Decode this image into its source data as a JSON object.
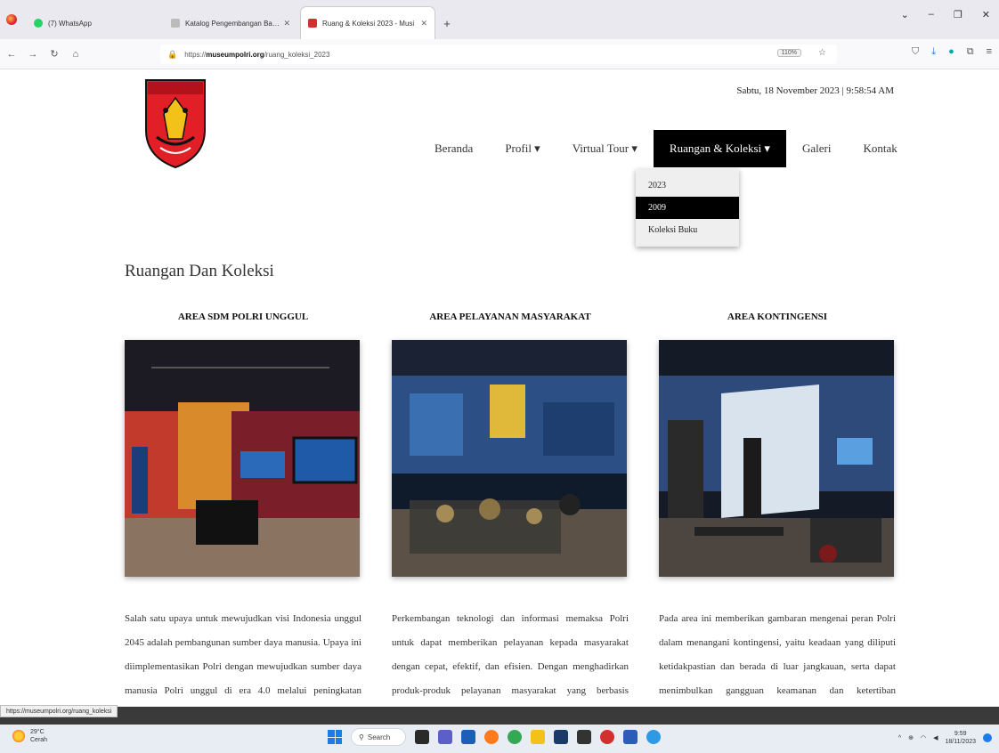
{
  "browser": {
    "tabs": [
      {
        "label": "(7) WhatsApp",
        "active": false,
        "color": "#25d366"
      },
      {
        "label": "Katalog Pengembangan Bagi An. (?)",
        "active": false,
        "color": "#888888"
      },
      {
        "label": "Ruang & Koleksi 2023 - Musi",
        "active": true,
        "color": "#d32f2f"
      }
    ],
    "new_tab": "+",
    "window_controls": [
      "⌄",
      "–",
      "❐",
      "✕"
    ],
    "url_prefix": "https://",
    "url_domain": "museumpolri.org",
    "url_path": "/ruang_koleksi_2023",
    "zoom": "110%"
  },
  "page": {
    "datetime": "Sabtu, 18 November 2023 | 9:58:54 AM",
    "nav": [
      {
        "label": "Beranda",
        "active": false
      },
      {
        "label": "Profil ▾",
        "active": false
      },
      {
        "label": "Virtual Tour ▾",
        "active": false
      },
      {
        "label": "Ruangan & Koleksi ▾",
        "active": true
      },
      {
        "label": "Galeri",
        "active": false
      },
      {
        "label": "Kontak",
        "active": false
      }
    ],
    "dropdown": [
      {
        "label": "2023",
        "selected": false
      },
      {
        "label": "2009",
        "selected": true
      },
      {
        "label": "Koleksi Buku",
        "selected": false
      }
    ],
    "section_title": "Ruangan Dan Koleksi",
    "cards": [
      {
        "title": "AREA SDM POLRI UNGGUL",
        "text": "Salah satu upaya untuk mewujudkan visi Indonesia unggul 2045 adalah pembangunan sumber daya manusia. Upaya ini diimplementasikan Polri dengan mewujudkan sumber daya manusia Polri unggul di era 4.0 melalui peningkatan kuantitas dan kualitas SDM"
      },
      {
        "title": "AREA PELAYANAN MASYARAKAT",
        "text": "Perkembangan teknologi dan informasi memaksa Polri untuk dapat memberikan pelayanan kepada masyarakat dengan cepat, efektif, dan efisien. Dengan menghadirkan produk-produk pelayanan masyarakat yang berbasis terhadap teknologi dan informasi, Polri"
      },
      {
        "title": "AREA KONTINGENSI",
        "text": "Pada area ini memberikan gambaran mengenai peran Polri dalam menangani kontingensi, yaitu keadaan yang diliputi ketidakpastian dan berada di luar jangkauan, serta dapat menimbulkan gangguan keamanan dan ketertiban masyarakat antara lain konflik sosial,"
      }
    ]
  },
  "status_url": "https://museumpolri.org/ruang_koleksi",
  "taskbar": {
    "weather_temp": "29°C",
    "weather_desc": "Cerah",
    "search_label": "Search",
    "time": "9:59",
    "date": "18/11/2023"
  }
}
